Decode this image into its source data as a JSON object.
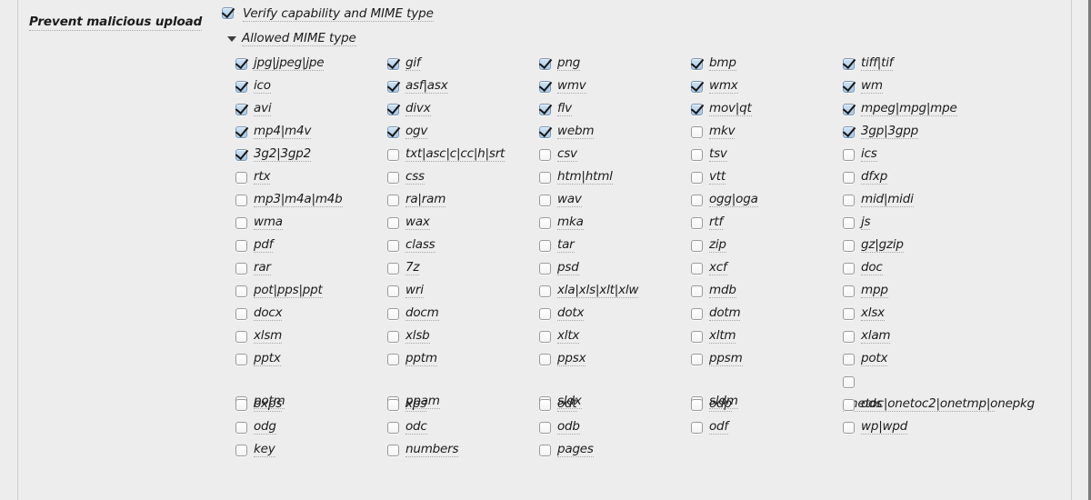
{
  "setting": {
    "label": "Prevent malicious upload",
    "verify": {
      "label": "Verify capability and MIME type",
      "checked": true,
      "icon": "checkbox-checked-icon"
    },
    "disclosure": {
      "label": "Allowed MIME type",
      "expanded": true,
      "icon": "triangle-down-icon"
    }
  },
  "colors": {
    "page_background": "#ededed",
    "rule": "#cfcfcf",
    "edge": "#7b7b7b",
    "text": "#1b1b1b",
    "underline": "#a8a8a8",
    "checkbox_border": "#9a9a9a",
    "checkbox_checked_fill": "#a9c9e6",
    "checkbox_checked_border": "#7e98b4",
    "checkmark": "#161616"
  },
  "grid": {
    "columns": 5,
    "rows": [
      [
        {
          "label": "jpg|jpeg|jpe",
          "checked": true
        },
        {
          "label": "gif",
          "checked": true
        },
        {
          "label": "png",
          "checked": true
        },
        {
          "label": "bmp",
          "checked": true
        },
        {
          "label": "tiff|tif",
          "checked": true
        }
      ],
      [
        {
          "label": "ico",
          "checked": true
        },
        {
          "label": "asf|asx",
          "checked": true
        },
        {
          "label": "wmv",
          "checked": true
        },
        {
          "label": "wmx",
          "checked": true
        },
        {
          "label": "wm",
          "checked": true
        }
      ],
      [
        {
          "label": "avi",
          "checked": true
        },
        {
          "label": "divx",
          "checked": true
        },
        {
          "label": "flv",
          "checked": true
        },
        {
          "label": "mov|qt",
          "checked": true
        },
        {
          "label": "mpeg|mpg|mpe",
          "checked": true
        }
      ],
      [
        {
          "label": "mp4|m4v",
          "checked": true
        },
        {
          "label": "ogv",
          "checked": true
        },
        {
          "label": "webm",
          "checked": true
        },
        {
          "label": "mkv",
          "checked": false
        },
        {
          "label": "3gp|3gpp",
          "checked": true
        }
      ],
      [
        {
          "label": "3g2|3gp2",
          "checked": true
        },
        {
          "label": "txt|asc|c|cc|h|srt",
          "checked": false
        },
        {
          "label": "csv",
          "checked": false
        },
        {
          "label": "tsv",
          "checked": false
        },
        {
          "label": "ics",
          "checked": false
        }
      ],
      [
        {
          "label": "rtx",
          "checked": false
        },
        {
          "label": "css",
          "checked": false
        },
        {
          "label": "htm|html",
          "checked": false
        },
        {
          "label": "vtt",
          "checked": false
        },
        {
          "label": "dfxp",
          "checked": false
        }
      ],
      [
        {
          "label": "mp3|m4a|m4b",
          "checked": false
        },
        {
          "label": "ra|ram",
          "checked": false
        },
        {
          "label": "wav",
          "checked": false
        },
        {
          "label": "ogg|oga",
          "checked": false
        },
        {
          "label": "mid|midi",
          "checked": false
        }
      ],
      [
        {
          "label": "wma",
          "checked": false
        },
        {
          "label": "wax",
          "checked": false
        },
        {
          "label": "mka",
          "checked": false
        },
        {
          "label": "rtf",
          "checked": false
        },
        {
          "label": "js",
          "checked": false
        }
      ],
      [
        {
          "label": "pdf",
          "checked": false
        },
        {
          "label": "class",
          "checked": false
        },
        {
          "label": "tar",
          "checked": false
        },
        {
          "label": "zip",
          "checked": false
        },
        {
          "label": "gz|gzip",
          "checked": false
        }
      ],
      [
        {
          "label": "rar",
          "checked": false
        },
        {
          "label": "7z",
          "checked": false
        },
        {
          "label": "psd",
          "checked": false
        },
        {
          "label": "xcf",
          "checked": false
        },
        {
          "label": "doc",
          "checked": false
        }
      ],
      [
        {
          "label": "pot|pps|ppt",
          "checked": false
        },
        {
          "label": "wri",
          "checked": false
        },
        {
          "label": "xla|xls|xlt|xlw",
          "checked": false
        },
        {
          "label": "mdb",
          "checked": false
        },
        {
          "label": "mpp",
          "checked": false
        }
      ],
      [
        {
          "label": "docx",
          "checked": false
        },
        {
          "label": "docm",
          "checked": false
        },
        {
          "label": "dotx",
          "checked": false
        },
        {
          "label": "dotm",
          "checked": false
        },
        {
          "label": "xlsx",
          "checked": false
        }
      ],
      [
        {
          "label": "xlsm",
          "checked": false
        },
        {
          "label": "xlsb",
          "checked": false
        },
        {
          "label": "xltx",
          "checked": false
        },
        {
          "label": "xltm",
          "checked": false
        },
        {
          "label": "xlam",
          "checked": false
        }
      ],
      [
        {
          "label": "pptx",
          "checked": false
        },
        {
          "label": "pptm",
          "checked": false
        },
        {
          "label": "ppsx",
          "checked": false
        },
        {
          "label": "ppsm",
          "checked": false
        },
        {
          "label": "potx",
          "checked": false
        }
      ],
      [
        {
          "label": "potm",
          "checked": false,
          "shift": true
        },
        {
          "label": "ppam",
          "checked": false,
          "shift": true
        },
        {
          "label": "sldx",
          "checked": false,
          "shift": true
        },
        {
          "label": "sldm",
          "checked": false,
          "shift": true
        },
        {
          "label": "onetoc|onetoc2|onetmp|onepkg",
          "checked": false,
          "wrap": true
        }
      ],
      [
        {
          "label": "oxps",
          "checked": false
        },
        {
          "label": "xps",
          "checked": false
        },
        {
          "label": "odt",
          "checked": false
        },
        {
          "label": "odp",
          "checked": false
        },
        {
          "label": "ods",
          "checked": false
        }
      ],
      [
        {
          "label": "odg",
          "checked": false
        },
        {
          "label": "odc",
          "checked": false
        },
        {
          "label": "odb",
          "checked": false
        },
        {
          "label": "odf",
          "checked": false
        },
        {
          "label": "wp|wpd",
          "checked": false
        }
      ],
      [
        {
          "label": "key",
          "checked": false
        },
        {
          "label": "numbers",
          "checked": false
        },
        {
          "label": "pages",
          "checked": false
        },
        null,
        null
      ]
    ]
  }
}
